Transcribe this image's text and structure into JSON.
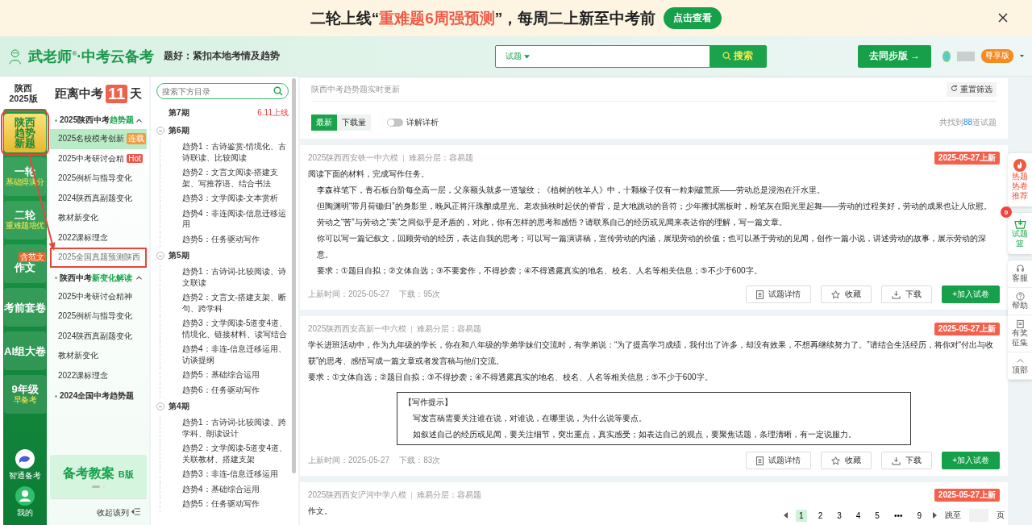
{
  "banner": {
    "before": "二轮上线“",
    "highlight": "重难题6周强预测",
    "after": "”，每周二上新至中考前",
    "button": "点击查看"
  },
  "header": {
    "logo": "武老师",
    "logo_mark": "®",
    "logo_suffix": "·中考云备考",
    "tagline": "题好：紧扣本地考情及趋势",
    "search_type": "试题",
    "search_button": "搜索",
    "sync_button": "去同步版 →",
    "member_badge": "尊享版"
  },
  "rail": {
    "region": "陕西",
    "edition": "2025版",
    "items": [
      {
        "title": "陕西趋势新题",
        "selected": true,
        "annotated": true
      },
      {
        "title": "一轮",
        "sub": "基础得满分",
        "selected": false,
        "annotated": false
      },
      {
        "title": "二轮",
        "sub": "重难题培优",
        "selected": false,
        "annotated": false
      },
      {
        "title": "作文",
        "badge": "含范文",
        "selected": false,
        "annotated": false
      },
      {
        "title": "考前套卷",
        "selected": false,
        "annotated": false
      },
      {
        "title": "AI组大卷",
        "selected": false,
        "annotated": false
      },
      {
        "title": "9年级",
        "sub": "早备考",
        "selected": false,
        "annotated": false
      }
    ],
    "bottom": [
      {
        "kind": "assistant",
        "label": "智通备考"
      },
      {
        "kind": "profile",
        "label": "我的"
      }
    ]
  },
  "countdown": {
    "before": "距离中考",
    "days": "11",
    "after": "天"
  },
  "groups": [
    {
      "title": "2025陕西中考",
      "highlight": "趋势题",
      "expanded": true,
      "items": [
        {
          "label": "2025名校模考创新",
          "badge": "连载",
          "color": "#f59a3a",
          "selected": true,
          "annotated": false
        },
        {
          "label": "2025中考研讨会精",
          "badge": "Hot",
          "color": "#f0564a",
          "selected": false,
          "annotated": false
        },
        {
          "label": "2025例析与指导变化",
          "selected": false,
          "annotated": false
        },
        {
          "label": "2024陕西真副题变化",
          "selected": false,
          "annotated": false
        },
        {
          "label": "教材新变化",
          "selected": false,
          "annotated": false
        },
        {
          "label": "2022课标理念",
          "selected": false,
          "annotated": false
        },
        {
          "label": "2025全国真题预测陕西",
          "selected": false,
          "annotated": true
        }
      ]
    },
    {
      "title": "陕西中考",
      "highlight": "新变化解读",
      "expanded": true,
      "items": [
        {
          "label": "2025中考研讨会精神",
          "selected": false,
          "annotated": false
        },
        {
          "label": "2025例析与指导变化",
          "selected": false,
          "annotated": false
        },
        {
          "label": "2024陕西真副题变化",
          "selected": false,
          "annotated": false
        },
        {
          "label": "教材新变化",
          "selected": false,
          "annotated": false
        },
        {
          "label": "2022课标理念",
          "selected": false,
          "annotated": false
        }
      ]
    },
    {
      "title": "2024全国中考趋势题",
      "expanded": false
    }
  ],
  "promo": {
    "title": "备考教案",
    "edition": "B版"
  },
  "collapse_label": "收起该列",
  "annotation_arrow": true,
  "tree": {
    "placeholder": "搜索下方目录",
    "periods": [
      {
        "title": "第7期",
        "note": "6.11上线"
      },
      {
        "title": "第6期",
        "expanded": true,
        "children": [
          {
            "label": "趋势1：古诗鉴赏-情境化、古诗联读、比较阅读"
          },
          {
            "label": "趋势2：文言文阅读-搭建支架、写推荐语、结合书法"
          },
          {
            "label": "趋势3：文学阅读-文本赏析"
          },
          {
            "label": "趋势4：非连阅读-信息迁移运用"
          },
          {
            "label": "趋势5：任务驱动写作"
          }
        ]
      },
      {
        "title": "第5期",
        "expanded": true,
        "children": [
          {
            "label": "趋势1：古诗词-比较阅读、诗文联读"
          },
          {
            "label": "趋势2：文言文-搭建支架、断句、跨学科"
          },
          {
            "label": "趋势3：文学阅读-5道变4道、情境化、链接材料、读写结合"
          },
          {
            "label": "趋势4：非连-信息迁移运用、访谈提纲"
          },
          {
            "label": "趋势5：基础综合运用"
          },
          {
            "label": "趋势6：任务驱动写作"
          }
        ]
      },
      {
        "title": "第4期",
        "expanded": true,
        "children": [
          {
            "label": "趋势1：古诗词-比较阅读、跨学科、朗读设计"
          },
          {
            "label": "趋势2：文学阅读-5道变4道、关联教材、搭建支架"
          },
          {
            "label": "趋势3：非连-信息迁移运用"
          },
          {
            "label": "趋势4：基础综合运用"
          },
          {
            "label": "趋势5：任务驱动写作"
          }
        ]
      }
    ]
  },
  "main": {
    "heading": "陕西中考趋势题实时更新",
    "reset": "重置筛选",
    "sorts": [
      {
        "label": "最新",
        "selected": true
      },
      {
        "label": "下载量",
        "selected": false
      }
    ],
    "toggle": {
      "label": "详解详析",
      "on": false
    },
    "count": {
      "before": "共找到",
      "value": "88",
      "after": "道试题"
    },
    "questions": [
      {
        "source": "2025陕西西安铁一中六模",
        "difficulty": "难易分层：容易题",
        "tag": "2025-05-27上新",
        "paragraphs": [
          {
            "text": "阅读下面的材料，完成写作任务。",
            "indent": false
          },
          {
            "text": "李森祥笔下，青石板台阶每垒高一层，父亲额头就多一道皱纹；《植树的牧羊人》中，十颗橡子仅有一粒刺破荒原——劳动总是浸泡在汗水里。",
            "indent": true
          },
          {
            "text": "但陶渊明“带月荷锄归”的身影里，晚风正将汗珠酿成星光。老农插秧时起伏的脊背，是大地跳动的音符；少年擦拭黑板时，粉笔灰在阳光里起舞——劳动的过程美好，劳动的成果也让人欣慰。",
            "indent": true
          },
          {
            "text": "劳动之“苦”与劳动之“美”之间似乎是矛盾的，对此，你有怎样的思考和感悟？请联系自己的经历或见闻来表达你的理解，写一篇文章。",
            "indent": true
          },
          {
            "text": "你可以写一篇记叙文，回顾劳动的经历，表达自我的思考；可以写一篇演讲稿，宣传劳动的内涵，展现劳动的价值；也可以基于劳动的见闻，创作一篇小说，讲述劳动的故事，展示劳动的深意。",
            "indent": true
          },
          {
            "text": "要求：①题目自拟；②文体自选；③不要套作，不得抄袭；④不得透露真实的地名、校名、人名等相关信息；⑤不少于600字。",
            "indent": true
          }
        ],
        "footer": {
          "updated": "上新时间：2025-05-27",
          "downloads": "下载：95次",
          "actions": [
            "试题详情",
            "收藏",
            "下载",
            "+加入试卷"
          ]
        }
      },
      {
        "source": "2025陕西西安高新一中六模",
        "difficulty": "难易分层：容易题",
        "tag": "2025-05-27上新",
        "paragraphs": [
          {
            "text": "学长进班活动中，作为九年级的学长，你在和八年级的学弟学妹们交流时，有学弟说：“为了提高学习成绩，我付出了许多，却没有效果，不想再继续努力了。”请结合生活经历，将你对“付出与收获”的思考、感悟写成一篇文章或者发言稿与他们交流。",
            "indent": false
          },
          {
            "text": "要求：①文体自选；②题目自拟；③不得抄袭；④不得透露真实的地名、校名、人名等相关信息；⑤不少于600字。",
            "indent": false
          }
        ],
        "hint": {
          "title": "【写作提示】",
          "lines": [
            "写发言稿需要关注谁在说，对谁说，在哪里说，为什么说等要点。",
            "如叙述自己的经历或见闻，要关注细节，突出重点，真实感受；如表达自己的观点，要聚焦话题，条理清晰，有一定说服力。"
          ]
        },
        "footer": {
          "updated": "上新时间：2025-05-27",
          "downloads": "下载：83次",
          "actions": [
            "试题详情",
            "收藏",
            "下载",
            "+加入试卷"
          ]
        }
      },
      {
        "source": "2025陕西西安浐河中学八模",
        "difficulty": "难易分层：容易题",
        "tag": "2025-05-27上新",
        "paragraphs": [
          {
            "text": "作文。",
            "indent": false
          }
        ]
      }
    ],
    "pagination": {
      "pages": [
        {
          "label": "1",
          "selected": true
        },
        {
          "label": "2",
          "selected": false
        },
        {
          "label": "3",
          "selected": false
        },
        {
          "label": "4",
          "selected": false
        },
        {
          "label": "5",
          "selected": false
        },
        {
          "label": "•••",
          "selected": false
        },
        {
          "label": "9",
          "selected": false
        }
      ],
      "jump_label": "跳至",
      "unit": "页"
    }
  },
  "float_bar": {
    "hot": "热题热卷推荐",
    "basket": "试题篮",
    "basket_count": "0",
    "items": [
      {
        "kind": "service",
        "label": "客服"
      },
      {
        "kind": "help",
        "label": "帮助"
      },
      {
        "kind": "collect",
        "label": "有奖征集"
      },
      {
        "kind": "top",
        "label": "顶部"
      }
    ]
  }
}
